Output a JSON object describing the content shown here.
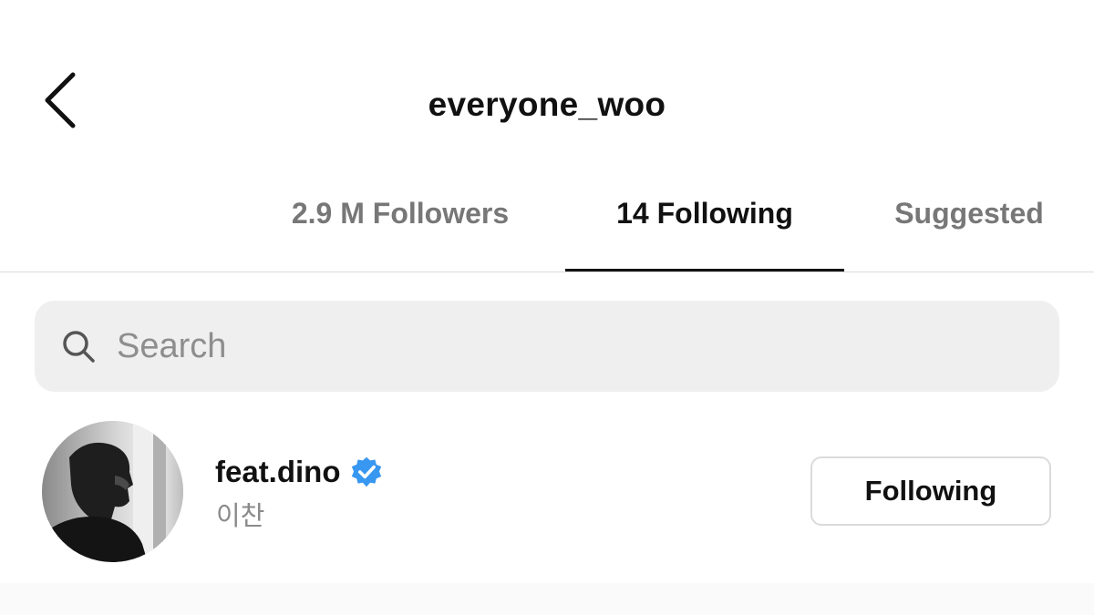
{
  "header": {
    "title": "everyone_woo",
    "back_icon": "chevron-left-icon"
  },
  "tabs": [
    {
      "label": "2.9 M Followers",
      "active": false
    },
    {
      "label": "14 Following",
      "active": true
    },
    {
      "label": "Suggested",
      "active": false
    }
  ],
  "search": {
    "placeholder": "Search",
    "value": "",
    "icon": "search-icon"
  },
  "list": [
    {
      "username": "feat.dino",
      "verified": true,
      "display_name": "이찬",
      "button_label": "Following"
    }
  ],
  "colors": {
    "verified_badge": "#3897f0",
    "tab_active": "#111111",
    "tab_inactive": "#777777",
    "search_background": "#efefef"
  }
}
